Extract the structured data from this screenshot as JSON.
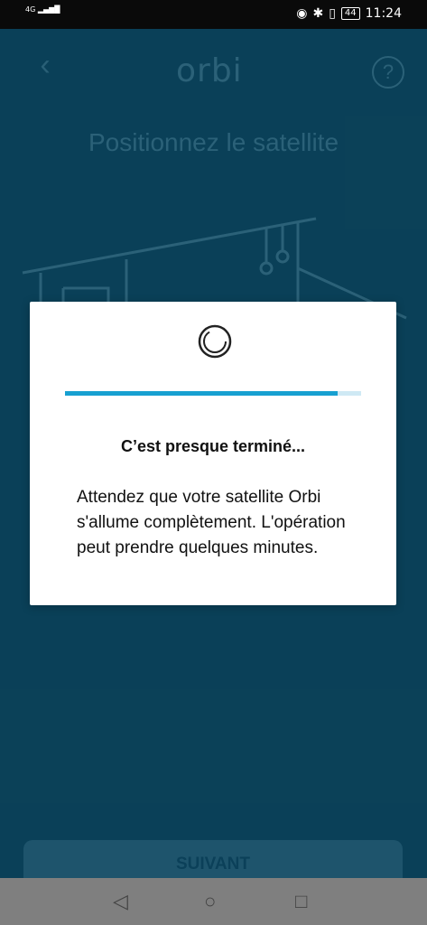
{
  "status_bar": {
    "network_label": "4G",
    "time": "11:24",
    "battery": "44",
    "icons": [
      "eye-icon",
      "bluetooth-icon",
      "vibrate-icon",
      "battery-icon"
    ]
  },
  "app": {
    "logo": "orbi",
    "title": "Positionnez le satellite",
    "next_button": "SUIVANT"
  },
  "dialog": {
    "title": "C’est presque terminé...",
    "message": "Attendez que votre satellite Orbi s'allume complètement. L'opération peut prendre quelques minutes.",
    "progress": 0.92
  },
  "nav_bar": {
    "icons": [
      "back-nav-icon",
      "home-nav-icon",
      "recents-nav-icon"
    ]
  }
}
